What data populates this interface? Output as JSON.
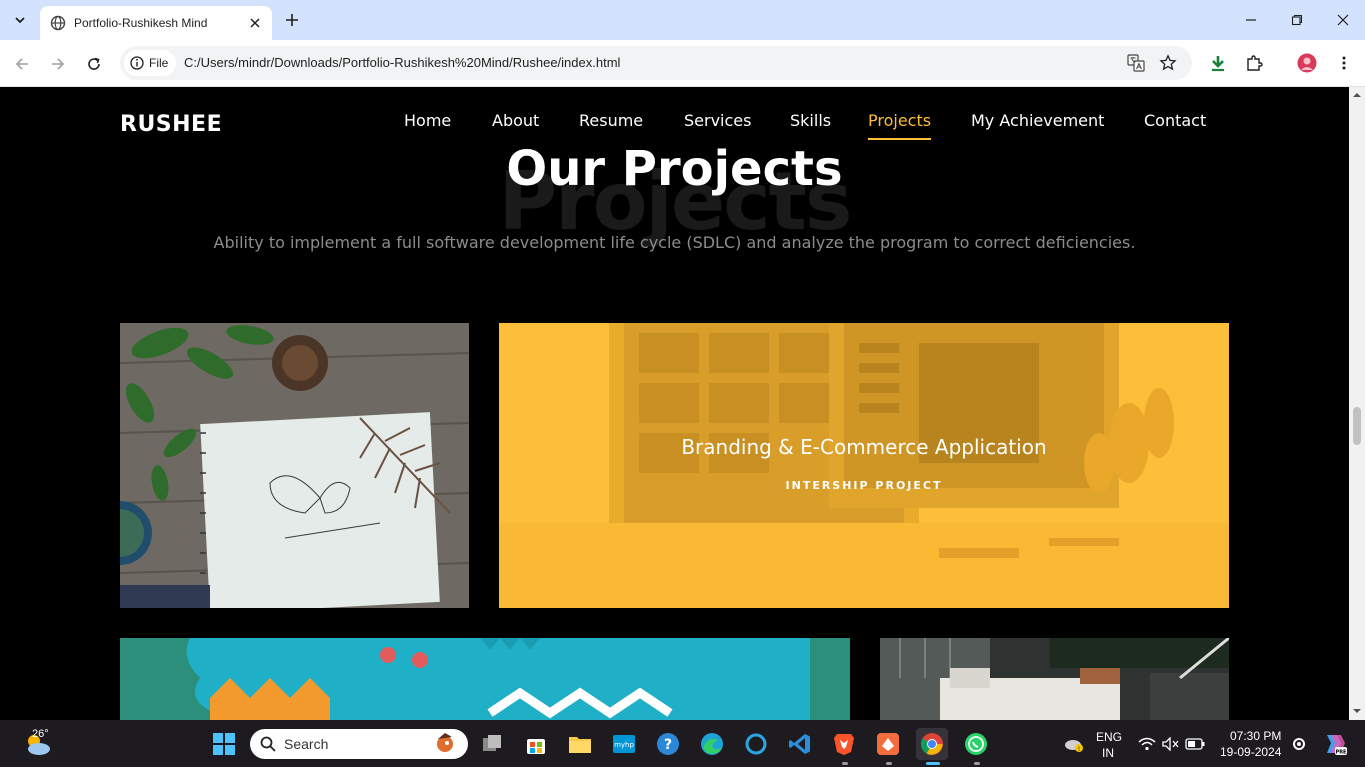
{
  "browser": {
    "tab_title": "Portfolio-Rushikesh Mind",
    "site_info_label": "File",
    "url": "C:/Users/mindr/Downloads/Portfolio-Rushikesh%20Mind/Rushee/index.html"
  },
  "site": {
    "logo": "RUSHEE",
    "nav": [
      "Home",
      "About",
      "Resume",
      "Services",
      "Skills",
      "Projects",
      "My Achievement",
      "Contact"
    ],
    "active_nav": "Projects",
    "accent_color": "#ffbd39"
  },
  "section": {
    "heading_bg": "Projects",
    "heading": "Our Projects",
    "subtitle": "Ability to implement a full software development life cycle (SDLC) and analyze the program to correct deficiencies."
  },
  "projects": [
    {
      "title": "",
      "subtitle": "",
      "image": "sketchbook-butterfly-photo"
    },
    {
      "title": "Branding & E-Commerce Application",
      "subtitle": "INTERSHIP PROJECT",
      "image": "desk-monitors-photo"
    },
    {
      "title": "",
      "subtitle": "",
      "image": "teal-crocodile-paper-art"
    },
    {
      "title": "",
      "subtitle": "",
      "image": "cafe-interior-photo"
    }
  ],
  "taskbar": {
    "weather": "26°",
    "search_placeholder": "Search",
    "language": "ENG",
    "region": "IN",
    "time": "07:30 PM",
    "date": "19-09-2024"
  }
}
